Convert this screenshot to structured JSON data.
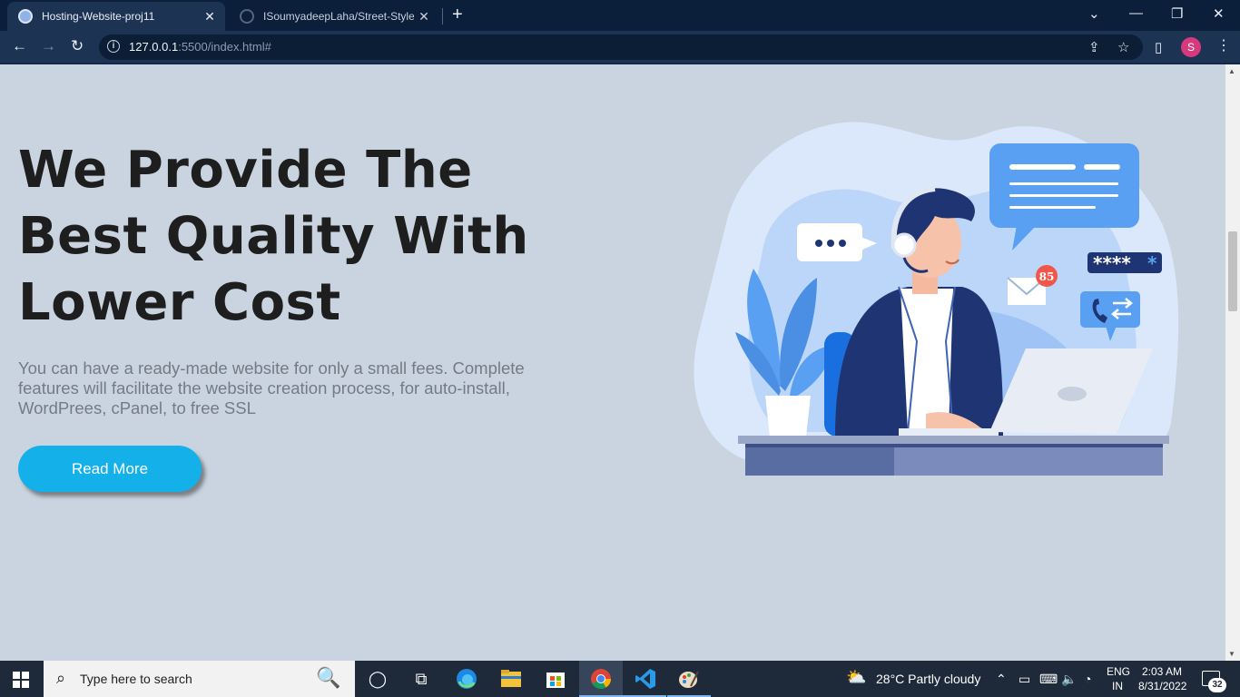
{
  "browser": {
    "tabs": [
      {
        "title": "Hosting-Website-proj11",
        "active": true
      },
      {
        "title": "ISoumyadeepLaha/Street-Style-L",
        "active": false
      }
    ],
    "new_tab": "+",
    "close_glyph": "✕",
    "url_host": "127.0.0.1",
    "url_rest": ":5500/index.html#",
    "profile_initial": "S"
  },
  "hero": {
    "title_line1": "We Provide The",
    "title_line2": "Best Quality With",
    "title_line3": "Lower Cost",
    "description": "You can have a ready-made website for only a small fees. Complete features will facilitate the website creation process, for auto-install, WordPrees, cPanel, to free SSL",
    "button_label": "Read More"
  },
  "illustration": {
    "mail_count": "85",
    "password_mask": "****",
    "password_cursor": "*"
  },
  "taskbar": {
    "search_placeholder": "Type here to search",
    "weather": "28°C  Partly cloudy",
    "lang_top": "ENG",
    "lang_bottom": "IN",
    "time": "2:03 AM",
    "date": "8/31/2022",
    "notification_count": "32"
  },
  "colors": {
    "page_bg": "#c9d4e0",
    "button_bg": "#14b0ea",
    "heading": "#1e1e1e",
    "body_text": "#757b84",
    "chrome_dark": "#0b1f3a"
  }
}
